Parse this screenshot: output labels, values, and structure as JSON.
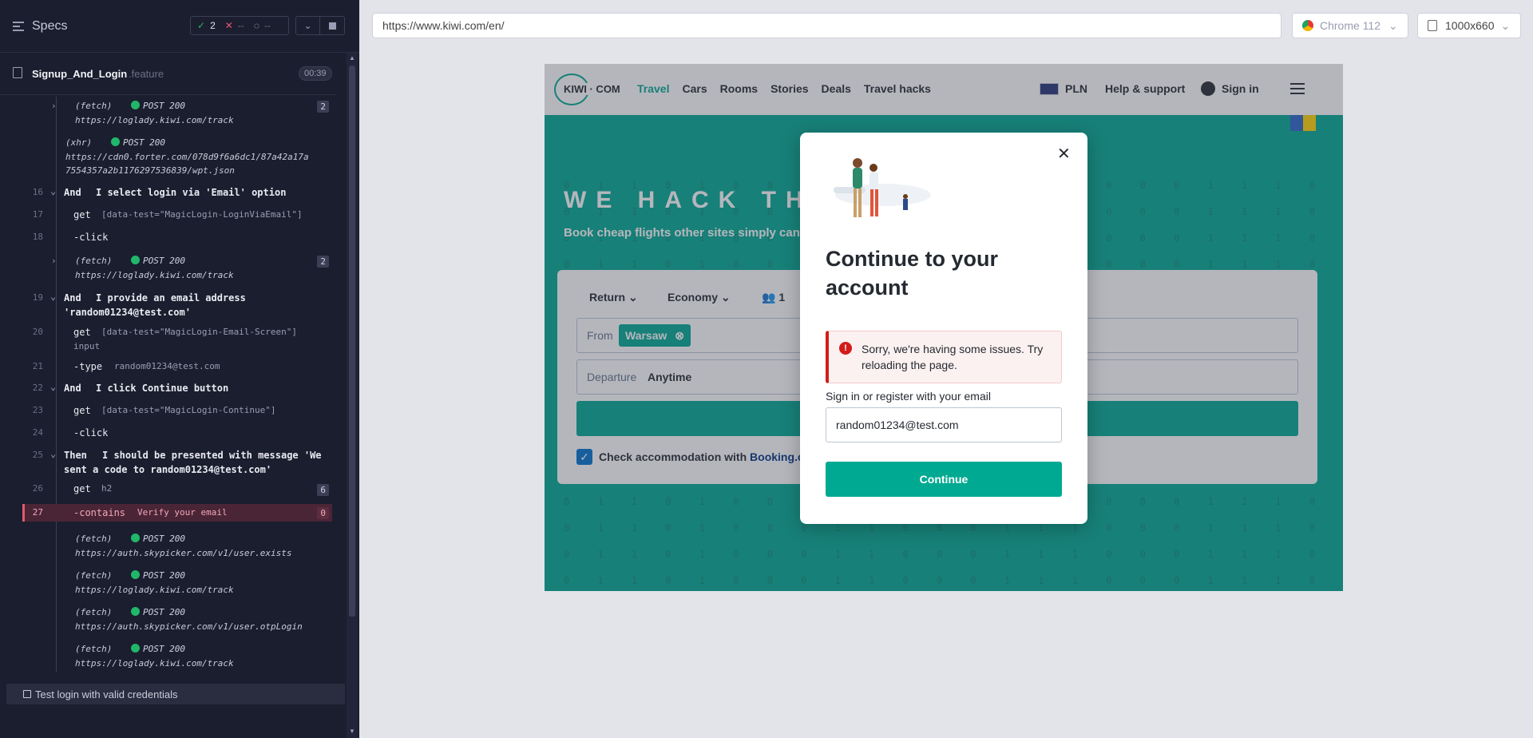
{
  "runner": {
    "specs_label": "Specs",
    "passed": "2",
    "failed": "--",
    "pending": "--",
    "spec_file": "Signup_And_Login",
    "spec_ext": ".feature",
    "duration": "00:39",
    "commands": [
      {
        "type": "fetch",
        "method": "POST 200",
        "url": "https://loglady.kiwi.com/track",
        "count": "2",
        "kind": "(fetch)"
      },
      {
        "type": "xhr",
        "kind": "(xhr)",
        "method": "POST 200",
        "url1": "https://cdn0.forter.com/078d9f6a6dc1/87a42a17a",
        "url2": "7554357a2b1176297536839/wpt.json"
      },
      {
        "num": "16",
        "keyword": "And",
        "text": "I select login via 'Email' option"
      },
      {
        "num": "17",
        "cmd": "get",
        "arg": "[data-test=\"MagicLogin-LoginViaEmail\"]"
      },
      {
        "num": "18",
        "cmd": "-click"
      },
      {
        "kind": "(fetch)",
        "method": "POST 200",
        "url": "https://loglady.kiwi.com/track",
        "count": "2"
      },
      {
        "num": "19",
        "keyword": "And",
        "text": "I provide an email address",
        "text2": "'random01234@test.com'"
      },
      {
        "num": "20",
        "cmd": "get",
        "arg": "[data-test=\"MagicLogin-Email-Screen\"]",
        "arg2": "input"
      },
      {
        "num": "21",
        "cmd": "-type",
        "arg": "random01234@test.com"
      },
      {
        "num": "22",
        "keyword": "And",
        "text": "I click Continue button"
      },
      {
        "num": "23",
        "cmd": "get",
        "arg": "[data-test=\"MagicLogin-Continue\"]"
      },
      {
        "num": "24",
        "cmd": "-click"
      },
      {
        "num": "25",
        "keyword": "Then",
        "text": "I should be presented with message 'We",
        "text2": "sent a code to random01234@test.com'"
      },
      {
        "num": "26",
        "cmd": "get",
        "arg": "h2",
        "count": "6"
      },
      {
        "num": "27",
        "cmd": "-contains",
        "arg": "Verify your email",
        "count": "0"
      },
      {
        "kind": "(fetch)",
        "method": "POST 200",
        "url": "https://auth.skypicker.com/v1/user.exists"
      },
      {
        "kind": "(fetch)",
        "method": "POST 200",
        "url": "https://loglady.kiwi.com/track"
      },
      {
        "kind": "(fetch)",
        "method": "POST 200",
        "url": "https://auth.skypicker.com/v1/user.otpLogin"
      },
      {
        "kind": "(fetch)",
        "method": "POST 200",
        "url": "https://loglady.kiwi.com/track"
      }
    ],
    "next_test": "Test login with valid credentials"
  },
  "browser": {
    "url": "https://www.kiwi.com/en/",
    "browser_label": "Chrome 112",
    "viewport": "1000x660"
  },
  "kiwi": {
    "logo": "KIWI · COM",
    "nav": [
      "Travel",
      "Cars",
      "Rooms",
      "Stories",
      "Deals",
      "Travel hacks"
    ],
    "currency": "PLN",
    "help": "Help & support",
    "signin": "Sign in",
    "hero_title": "WE HACK THE",
    "hero_sub": "Book cheap flights other sites simply can't",
    "trip_type": "Return",
    "cabin": "Economy",
    "passengers": "1",
    "from_label": "From",
    "from_value": "Warsaw",
    "departure_label": "Departure",
    "departure_value": "Anytime",
    "accommodation": "Check accommodation with",
    "booking": "Booking.co",
    "binary_row": "0 1 1 0 1 0 0 0 1 1 0 0 0 1 1 1 0 0 0 1 1 1 0 0 1 1 0 1 1 0 0 1"
  },
  "modal": {
    "title": "Continue to your account",
    "error": "Sorry, we're having some issues. Try reloading the page.",
    "email_label": "Sign in or register with your email",
    "email_value": "random01234@test.com",
    "continue": "Continue"
  },
  "colors": {
    "kiwi_teal": "#00a991",
    "error_red": "#d21c1c",
    "runner_bg": "#1b1e2e"
  }
}
